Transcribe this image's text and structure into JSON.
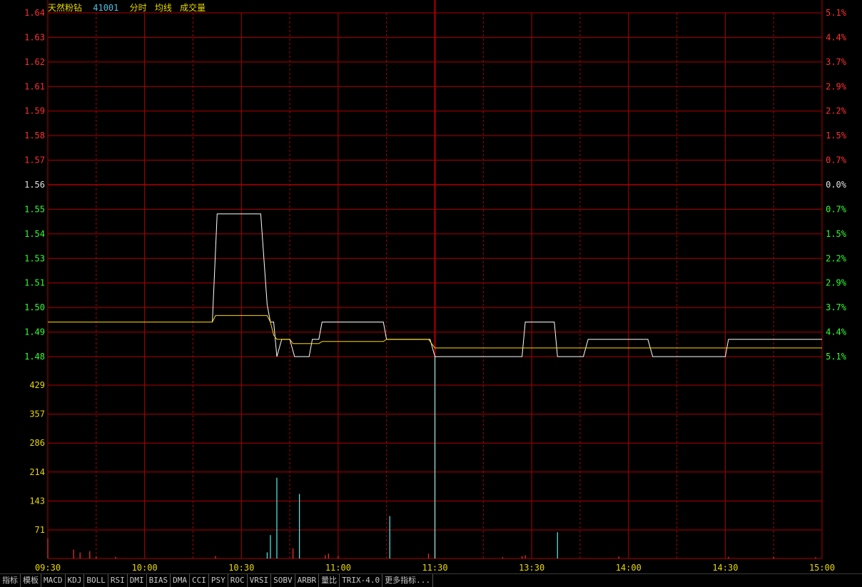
{
  "header": {
    "stock_name": "天然粉钻",
    "stock_code": "41001",
    "label_fenshi": "分时",
    "label_junxian": "均线",
    "label_volume": "成交量"
  },
  "colors": {
    "grid": "#b00000",
    "price_line": "#ffffff",
    "avg_line": "#ffd700",
    "up": "#ff3030",
    "down": "#30ff30",
    "neutral": "#e0e0e0",
    "volume_label": "#e8d800",
    "volume_up": "#ff3030",
    "volume_down": "#50f0f0",
    "header_name": "#e8d800",
    "header_code": "#50c0e0"
  },
  "tabs": [
    "指标",
    "模板",
    "MACD",
    "KDJ",
    "BOLL",
    "RSI",
    "DMI",
    "BIAS",
    "DMA",
    "CCI",
    "PSY",
    "ROC",
    "VRSI",
    "SOBV",
    "ARBR",
    "量比",
    "TRIX-4.0",
    "更多指标..."
  ],
  "chart_data": {
    "type": "line",
    "price_axis": {
      "ticks": [
        "1.64",
        "1.63",
        "1.62",
        "1.61",
        "1.59",
        "1.58",
        "1.57",
        "1.56",
        "1.55",
        "1.54",
        "1.53",
        "1.51",
        "1.50",
        "1.49",
        "1.48"
      ],
      "pct_ticks": [
        "5.1%",
        "4.4%",
        "3.7%",
        "2.9%",
        "2.2%",
        "1.5%",
        "0.7%",
        "0.0%",
        "0.7%",
        "1.5%",
        "2.2%",
        "2.9%",
        "3.7%",
        "4.4%",
        "5.1%"
      ],
      "ylim": [
        1.4805,
        1.6395
      ],
      "prev_close": 1.56
    },
    "volume_axis": {
      "ticks": [
        "429",
        "357",
        "286",
        "214",
        "143",
        "71"
      ],
      "ylim": [
        0,
        500
      ]
    },
    "x_ticks": [
      "09:30",
      "10:00",
      "10:30",
      "11:30",
      "13:30",
      "14:00",
      "14:30",
      "15:00"
    ],
    "x_tick_minutes": [
      0,
      30,
      60,
      120,
      150,
      180,
      210,
      240
    ],
    "tick_11_00": "11:00",
    "tick_11_00_minute": 90,
    "series": [
      {
        "key": "price",
        "points": [
          [
            0,
            1.4965
          ],
          [
            51,
            1.4965
          ],
          [
            52.5,
            1.5465
          ],
          [
            66,
            1.5465
          ],
          [
            68,
            1.5045
          ],
          [
            69,
            1.4965
          ],
          [
            70,
            1.4965
          ],
          [
            71,
            1.4805
          ],
          [
            72.5,
            1.4885
          ],
          [
            75,
            1.4885
          ],
          [
            76.5,
            1.4805
          ],
          [
            81,
            1.4805
          ],
          [
            82,
            1.4885
          ],
          [
            84,
            1.4885
          ],
          [
            85,
            1.4965
          ],
          [
            104,
            1.4965
          ],
          [
            105,
            1.4885
          ],
          [
            118.5,
            1.4885
          ],
          [
            120,
            1.4805
          ],
          [
            147,
            1.4805
          ],
          [
            148,
            1.4965
          ],
          [
            157,
            1.4965
          ],
          [
            158,
            1.4805
          ],
          [
            166,
            1.4805
          ],
          [
            167.5,
            1.4885
          ],
          [
            186,
            1.4885
          ],
          [
            187.5,
            1.4805
          ],
          [
            210,
            1.4805
          ],
          [
            211,
            1.4885
          ],
          [
            240,
            1.4885
          ]
        ]
      },
      {
        "key": "avg",
        "points": [
          [
            0,
            1.4965
          ],
          [
            51,
            1.4965
          ],
          [
            52,
            1.4995
          ],
          [
            68,
            1.4995
          ],
          [
            69,
            1.4965
          ],
          [
            70,
            1.4905
          ],
          [
            71,
            1.4885
          ],
          [
            75,
            1.4885
          ],
          [
            76,
            1.4865
          ],
          [
            84,
            1.4865
          ],
          [
            85,
            1.4875
          ],
          [
            104,
            1.4875
          ],
          [
            105,
            1.4885
          ],
          [
            118,
            1.4885
          ],
          [
            120,
            1.4845
          ],
          [
            240,
            1.4845
          ]
        ]
      }
    ],
    "volume": [
      {
        "t": 0,
        "v": 50,
        "dir": "up"
      },
      {
        "t": 8,
        "v": 22,
        "dir": "up"
      },
      {
        "t": 10,
        "v": 15,
        "dir": "up"
      },
      {
        "t": 13,
        "v": 18,
        "dir": "up"
      },
      {
        "t": 15,
        "v": 5,
        "dir": "up"
      },
      {
        "t": 21,
        "v": 4,
        "dir": "up"
      },
      {
        "t": 52,
        "v": 6,
        "dir": "up"
      },
      {
        "t": 68,
        "v": 15,
        "dir": "down"
      },
      {
        "t": 69,
        "v": 58,
        "dir": "down"
      },
      {
        "t": 71,
        "v": 200,
        "dir": "down"
      },
      {
        "t": 76,
        "v": 25,
        "dir": "up"
      },
      {
        "t": 78,
        "v": 160,
        "dir": "down"
      },
      {
        "t": 86,
        "v": 8,
        "dir": "up"
      },
      {
        "t": 87,
        "v": 12,
        "dir": "up"
      },
      {
        "t": 90,
        "v": 6,
        "dir": "up"
      },
      {
        "t": 106,
        "v": 105,
        "dir": "down"
      },
      {
        "t": 118,
        "v": 12,
        "dir": "up"
      },
      {
        "t": 120,
        "v": 500,
        "dir": "down"
      },
      {
        "t": 141,
        "v": 3,
        "dir": "up"
      },
      {
        "t": 147,
        "v": 6,
        "dir": "up"
      },
      {
        "t": 148,
        "v": 8,
        "dir": "up"
      },
      {
        "t": 158,
        "v": 65,
        "dir": "down"
      },
      {
        "t": 177,
        "v": 5,
        "dir": "up"
      },
      {
        "t": 211,
        "v": 4,
        "dir": "up"
      },
      {
        "t": 225,
        "v": 4,
        "dir": "up"
      },
      {
        "t": 238,
        "v": 3,
        "dir": "up"
      }
    ]
  }
}
